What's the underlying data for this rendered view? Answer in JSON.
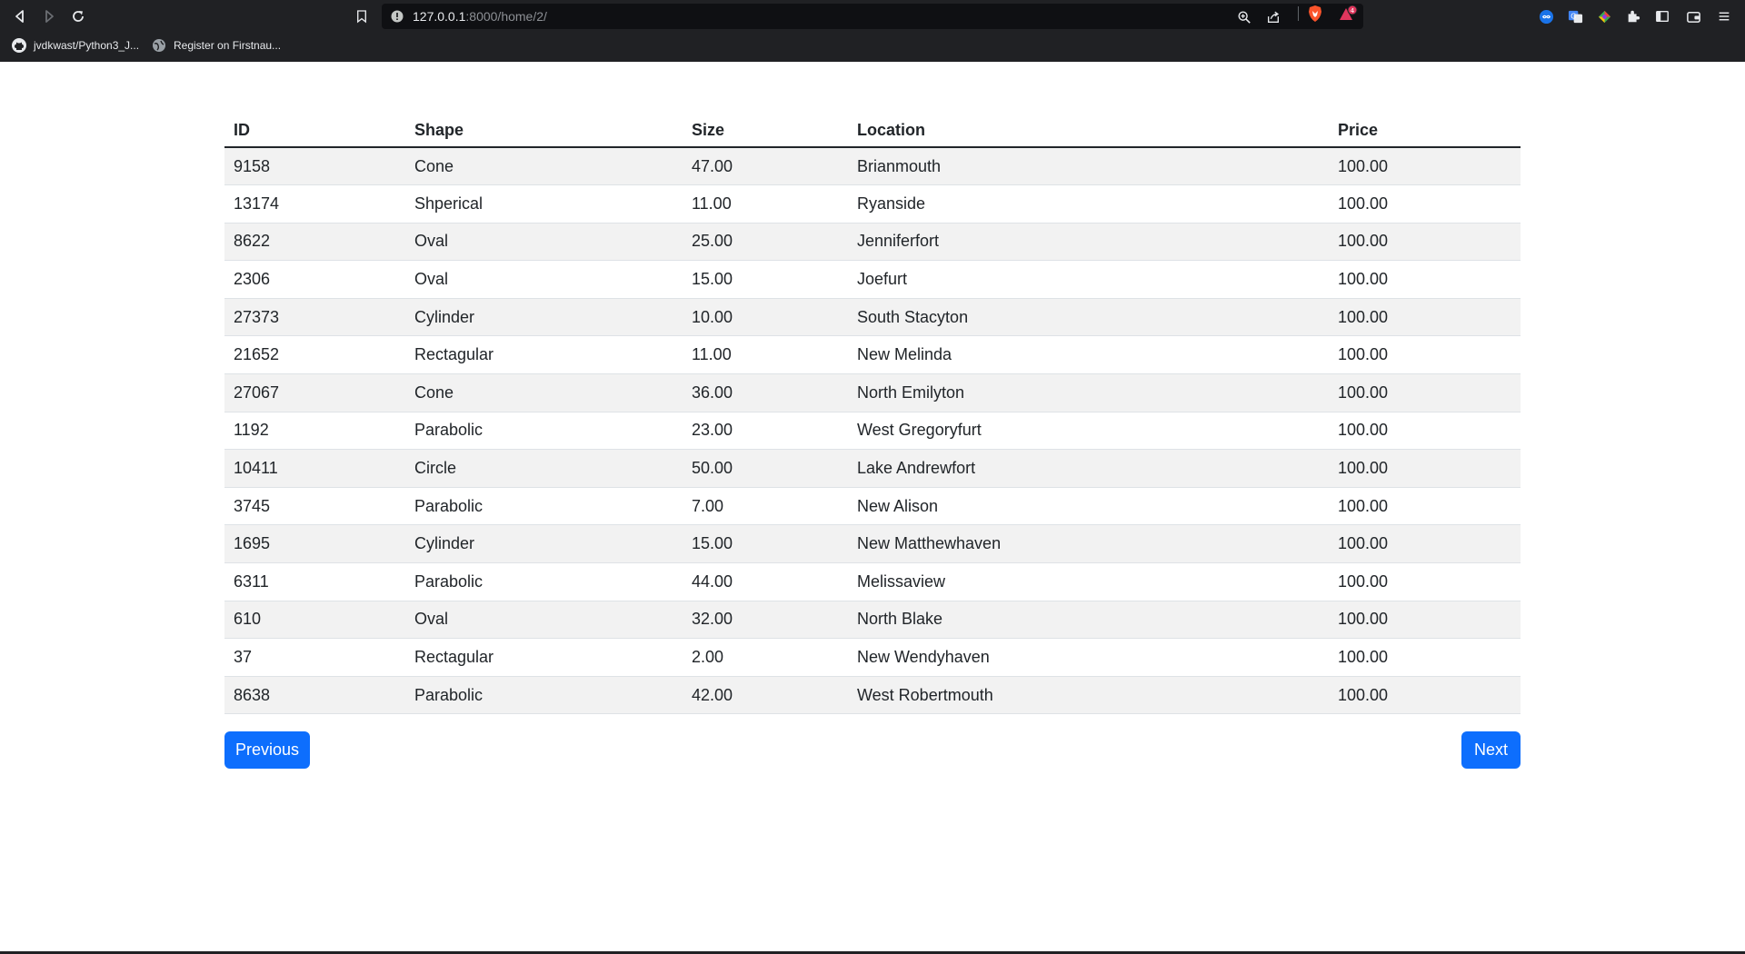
{
  "browser": {
    "url_host": "127.0.0.1",
    "url_path": ":8000/home/2/",
    "rewards_badge": "4",
    "bookmarks": [
      {
        "label": "jvdkwast/Python3_J..."
      },
      {
        "label": "Register on Firstnau..."
      }
    ]
  },
  "table": {
    "headers": {
      "id": "ID",
      "shape": "Shape",
      "size": "Size",
      "location": "Location",
      "price": "Price"
    },
    "rows": [
      {
        "id": "9158",
        "shape": "Cone",
        "size": "47.00",
        "location": "Brianmouth",
        "price": "100.00"
      },
      {
        "id": "13174",
        "shape": "Shperical",
        "size": "11.00",
        "location": "Ryanside",
        "price": "100.00"
      },
      {
        "id": "8622",
        "shape": "Oval",
        "size": "25.00",
        "location": "Jenniferfort",
        "price": "100.00"
      },
      {
        "id": "2306",
        "shape": "Oval",
        "size": "15.00",
        "location": "Joefurt",
        "price": "100.00"
      },
      {
        "id": "27373",
        "shape": "Cylinder",
        "size": "10.00",
        "location": "South Stacyton",
        "price": "100.00"
      },
      {
        "id": "21652",
        "shape": "Rectagular",
        "size": "11.00",
        "location": "New Melinda",
        "price": "100.00"
      },
      {
        "id": "27067",
        "shape": "Cone",
        "size": "36.00",
        "location": "North Emilyton",
        "price": "100.00"
      },
      {
        "id": "1192",
        "shape": "Parabolic",
        "size": "23.00",
        "location": "West Gregoryfurt",
        "price": "100.00"
      },
      {
        "id": "10411",
        "shape": "Circle",
        "size": "50.00",
        "location": "Lake Andrewfort",
        "price": "100.00"
      },
      {
        "id": "3745",
        "shape": "Parabolic",
        "size": "7.00",
        "location": "New Alison",
        "price": "100.00"
      },
      {
        "id": "1695",
        "shape": "Cylinder",
        "size": "15.00",
        "location": "New Matthewhaven",
        "price": "100.00"
      },
      {
        "id": "6311",
        "shape": "Parabolic",
        "size": "44.00",
        "location": "Melissaview",
        "price": "100.00"
      },
      {
        "id": "610",
        "shape": "Oval",
        "size": "32.00",
        "location": "North Blake",
        "price": "100.00"
      },
      {
        "id": "37",
        "shape": "Rectagular",
        "size": "2.00",
        "location": "New Wendyhaven",
        "price": "100.00"
      },
      {
        "id": "8638",
        "shape": "Parabolic",
        "size": "42.00",
        "location": "West Robertmouth",
        "price": "100.00"
      }
    ]
  },
  "pagination": {
    "previous_label": "Previous",
    "next_label": "Next"
  },
  "colors": {
    "chrome_bg": "#202124",
    "button_primary": "#0d6efd",
    "row_stripe": "#f2f2f2"
  },
  "icons": [
    "back-icon",
    "forward-icon",
    "reload-icon",
    "bookmark-icon",
    "site-info-icon",
    "zoom-icon",
    "share-icon",
    "brave-shields-icon",
    "brave-rewards-icon",
    "github-icon",
    "globe-icon",
    "extensions-icon",
    "sidebar-icon",
    "wallet-icon",
    "menu-icon"
  ]
}
